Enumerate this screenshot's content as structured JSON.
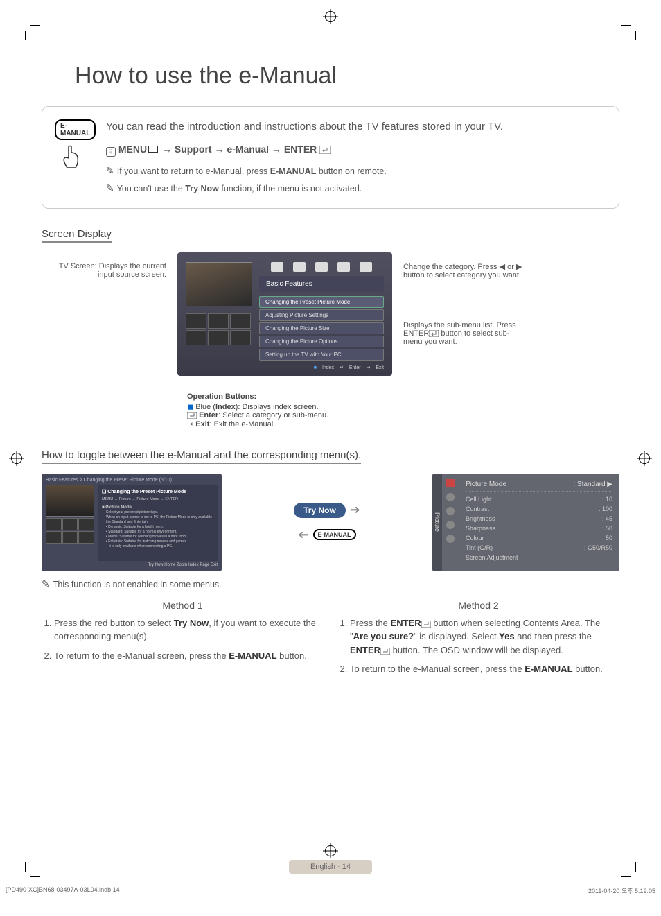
{
  "title": "How to use the e-Manual",
  "intro": {
    "badge": "E-MANUAL",
    "text": "You can read the introduction and instructions about the TV features stored in your TV.",
    "nav_prefix": "MENU",
    "nav_arrow": "→",
    "nav_support": "Support",
    "nav_emanual": "e-Manual",
    "nav_enter": "ENTER",
    "note1_a": "If you want to return to e-Manual, press ",
    "note1_b": "E-MANUAL",
    "note1_c": " button on remote.",
    "note2_a": "You can't use the ",
    "note2_b": "Try Now",
    "note2_c": " function, if the menu is not activated."
  },
  "screen": {
    "heading": "Screen Display",
    "left_caption": "TV Screen: Displays the current input source screen.",
    "panel_label": "Basic Features",
    "menu_items": [
      "Changing the Preset Picture Mode",
      "Adjusting Picture Settings",
      "Changing the Picture Size",
      "Changing the Picture Options",
      "Setting up the TV with Your PC"
    ],
    "ops_bar": {
      "index": "Index",
      "enter": "Enter",
      "exit": "Exit"
    },
    "right_cap1": "Change the category. Press ◀ or ▶ button to select category you want.",
    "right_cap2": "Displays the sub-menu list. Press ENTER",
    "right_cap2b": " button to select sub-menu you want."
  },
  "ops": {
    "heading": "Operation Buttons:",
    "blue": "Blue (",
    "blue_b": "Index",
    "blue_c": "): Displays index screen.",
    "enter_b": "Enter",
    "enter_c": ": Select a category or sub-menu.",
    "exit_b": "Exit",
    "exit_c": ": Exit the e-Manual."
  },
  "toggle": {
    "heading": "How to toggle between the e-Manual and the corresponding menu(s).",
    "breadcrumb": "Basic Features > Changing the Preset Picture Mode (5/10)",
    "detail_hd": "Changing the Preset Picture Mode",
    "detail_nav": "MENU → Picture → Picture Mode → ENTER",
    "picture_mode_hd": "Picture Mode",
    "detail_line0": "Select your preferred picture type.",
    "detail_line1": "When an input source is set to PC, the Picture Mode is only available the Standard and Entertain.",
    "detail_line2": "Dynamic: Suitable for a bright room.",
    "detail_line3": "Standard: Suitable for a normal environment.",
    "detail_line4": "Movie: Suitable for watching movies in a dark room.",
    "detail_line5": "Entertain: Suitable for watching movies and games.",
    "detail_line6": "It is only available when connecting a PC.",
    "detail_bar": "Try Now   Home   Zoom   Index   Page   Exit",
    "trynow": "Try Now",
    "emanual": "E-MANUAL",
    "rp_tab": "Picture",
    "rp_hd_l": "Picture Mode",
    "rp_hd_r": ": Standard",
    "rp_rows": [
      {
        "l": "Cell Light",
        "r": ": 10"
      },
      {
        "l": "Contrast",
        "r": ": 100"
      },
      {
        "l": "Brightness",
        "r": ": 45"
      },
      {
        "l": "Sharpness",
        "r": ": 50"
      },
      {
        "l": "Colour",
        "r": ": 50"
      },
      {
        "l": "Tint (G/R)",
        "r": ": G50/R50"
      },
      {
        "l": "Screen Adjustment",
        "r": ""
      }
    ],
    "note": "This function is not enabled in some menus."
  },
  "methods": {
    "m1_hd": "Method 1",
    "m2_hd": "Method 2",
    "m1_1a": "Press the red button to select ",
    "m1_1b": "Try Now",
    "m1_1c": ", if you want to execute the corresponding menu(s).",
    "m1_2a": "To return to the e-Manual screen, press the ",
    "m1_2b": "E-MANUAL",
    "m1_2c": " button.",
    "m2_1a": "Press the ",
    "m2_1b": "ENTER",
    "m2_1c": " button when selecting Contents Area. The \"",
    "m2_1d": "Are you sure?",
    "m2_1e": "\" is displayed. Select ",
    "m2_1f": "Yes",
    "m2_1g": " and then press the ",
    "m2_1h": "ENTER",
    "m2_1i": " button. The OSD window will be displayed.",
    "m2_2a": "To return to the e-Manual screen, press the ",
    "m2_2b": "E-MANUAL",
    "m2_2c": " button."
  },
  "footer": {
    "badge": "English - 14",
    "file": "[PD490-XC]BN68-03497A-03L04.indb   14",
    "date": "2011-04-20   오후 5:19:05"
  }
}
